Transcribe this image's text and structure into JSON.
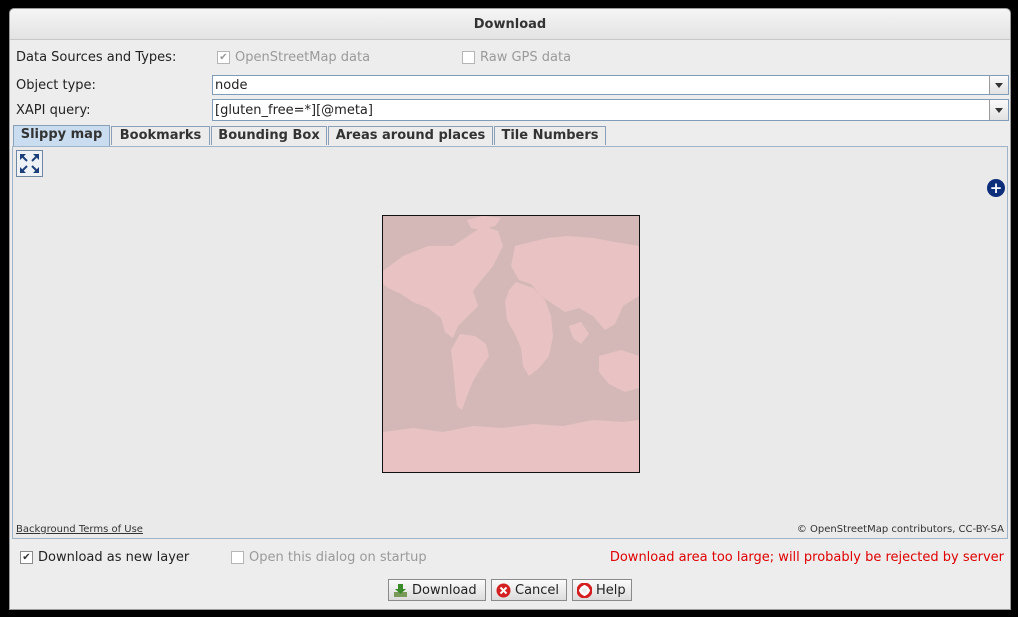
{
  "window": {
    "title": "Download"
  },
  "sources": {
    "label": "Data Sources and Types:",
    "osm_label": "OpenStreetMap data",
    "osm_checked": true,
    "gps_label": "Raw GPS data",
    "gps_checked": false
  },
  "object_type": {
    "label": "Object type:",
    "value": "node"
  },
  "xapi": {
    "label": "XAPI query:",
    "value": "[gluten_free=*][@meta]"
  },
  "tabs": [
    {
      "label": "Slippy map",
      "active": true
    },
    {
      "label": "Bookmarks"
    },
    {
      "label": "Bounding Box"
    },
    {
      "label": "Areas around places"
    },
    {
      "label": "Tile Numbers"
    }
  ],
  "map": {
    "attribution_left": "Background Terms of Use",
    "attribution_right": "© OpenStreetMap contributors, CC-BY-SA"
  },
  "options": {
    "new_layer_label": "Download as new layer",
    "new_layer_checked": true,
    "startup_label": "Open this dialog on startup",
    "startup_checked": false,
    "warning": "Download area too large; will probably be rejected by server"
  },
  "buttons": {
    "download": "Download",
    "cancel": "Cancel",
    "help": "Help"
  },
  "colors": {
    "warning": "#e00000",
    "map_ocean": "#d4b8b8",
    "map_land": "#e8c4c4",
    "tab_active": "#c9dcf0"
  }
}
